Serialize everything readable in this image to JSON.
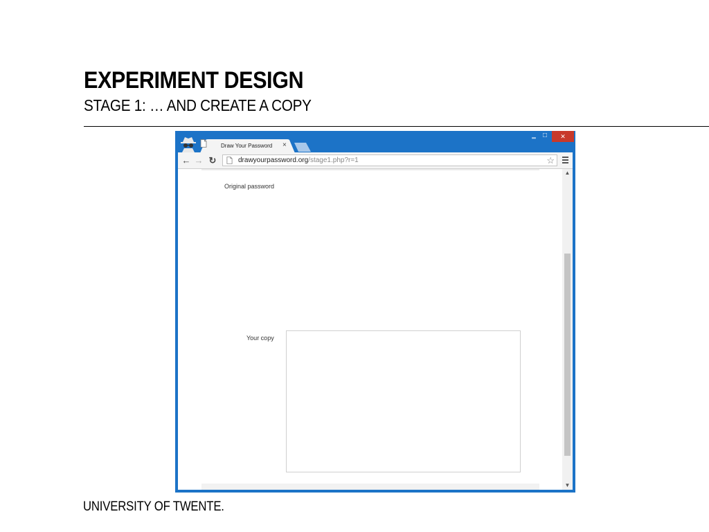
{
  "slide": {
    "title": "EXPERIMENT DESIGN",
    "subtitle": "STAGE 1: … AND CREATE A COPY",
    "footer": "UNIVERSITY OF TWENTE."
  },
  "browser": {
    "tab_title": "Draw Your Password",
    "tab_close": "×",
    "url_host": "drawyourpassword.org",
    "url_path": "/stage1.php?r=1",
    "star": "☆",
    "minimize": "‗",
    "maximize": "□",
    "close": "✕",
    "back": "←",
    "forward": "→",
    "reload": "↻"
  },
  "page": {
    "original_label": "Original password",
    "copy_label": "Your copy"
  },
  "scroll": {
    "up": "▲",
    "down": "▼"
  },
  "colors": {
    "window_frame": "#1c73c7",
    "close_button": "#c8392b"
  }
}
